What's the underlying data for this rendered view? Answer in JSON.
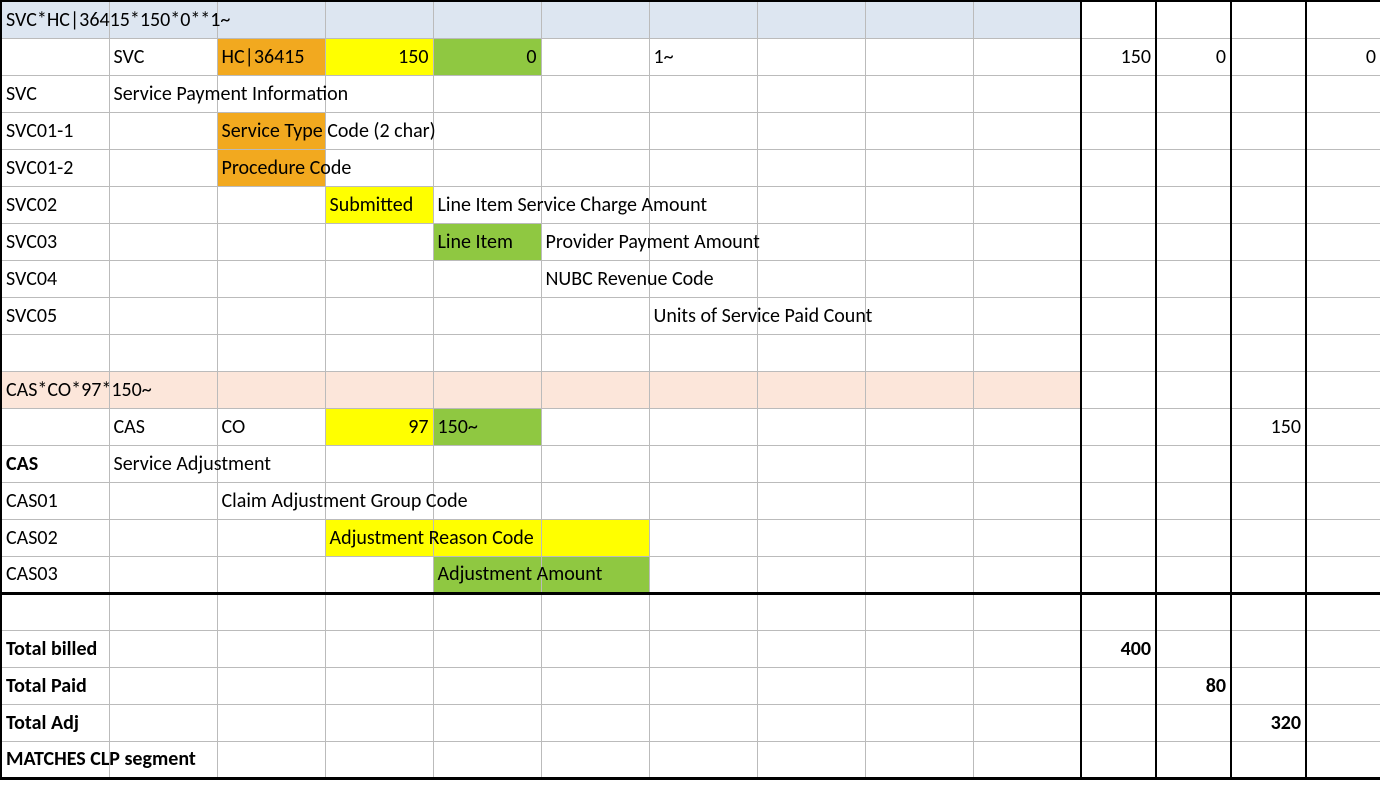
{
  "svc_header": "SVC*HC|36415*150*0**1~",
  "svc_row": {
    "seg": "SVC",
    "c3": "HC|36415",
    "c4": "150",
    "c5": "0",
    "c7": "1~",
    "n_billed": "150",
    "n_paid": "0",
    "n_adj": "",
    "n_last": "0"
  },
  "svc_defs": {
    "SVC": {
      "label": "SVC",
      "desc": "Service Payment Information"
    },
    "SVC011": {
      "label": "SVC01-1",
      "desc": "Service Type Code (2 char)"
    },
    "SVC012": {
      "label": "SVC01-2",
      "desc": "Procedure Code"
    },
    "SVC02": {
      "label": "SVC02",
      "hl": "Submitted",
      "desc": "Line Item Service Charge Amount"
    },
    "SVC03": {
      "label": "SVC03",
      "hl": "Line Item",
      "desc": "Provider Payment Amount"
    },
    "SVC04": {
      "label": "SVC04",
      "desc": "NUBC Revenue Code"
    },
    "SVC05": {
      "label": "SVC05",
      "desc": "Units of Service Paid Count"
    }
  },
  "cas_header": "CAS*CO*97*150~",
  "cas_row": {
    "seg": "CAS",
    "c3": "CO",
    "c4": "97",
    "c5": "150~",
    "n_adj": "150"
  },
  "cas_defs": {
    "CAS": {
      "label": "CAS",
      "desc": "Service Adjustment"
    },
    "CAS01": {
      "label": "CAS01",
      "desc": "Claim Adjustment Group Code"
    },
    "CAS02": {
      "label": "CAS02",
      "desc": "Adjustment Reason Code"
    },
    "CAS03": {
      "label": "CAS03",
      "desc": "Adjustment Amount"
    }
  },
  "totals": {
    "billed": {
      "label": "Total billed",
      "value": "400"
    },
    "paid": {
      "label": "Total Paid",
      "value": "80"
    },
    "adj": {
      "label": "Total Adj",
      "value": "320"
    },
    "match": "MATCHES CLP segment"
  }
}
